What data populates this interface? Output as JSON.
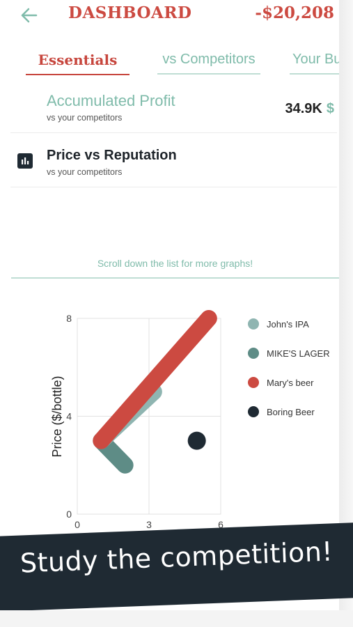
{
  "header": {
    "title": "DASHBOARD",
    "balance": "-$20,208",
    "back_icon": "arrow-left-icon"
  },
  "tabs": [
    {
      "label": "Essentials",
      "active": true
    },
    {
      "label": "vs Competitors",
      "active": false
    },
    {
      "label": "Your Bu",
      "active": false
    }
  ],
  "cards": {
    "profit": {
      "title": "Accumulated Profit",
      "subtitle": "vs your competitors",
      "value": "34.9K",
      "currency": "$"
    },
    "price_rep": {
      "title": "Price vs Reputation",
      "subtitle": "vs your competitors",
      "icon": "bar-chart-icon"
    }
  },
  "scroll_hint": "Scroll down the list for more graphs!",
  "colors": {
    "accent_red": "#cc4a41",
    "accent_teal": "#7fbbaa",
    "dark": "#1f2a33"
  },
  "chart_data": {
    "type": "line",
    "title": "",
    "xlabel": "",
    "ylabel": "Price ($/bottle)",
    "xlim": [
      0,
      6
    ],
    "ylim": [
      0,
      8
    ],
    "xticks": [
      "0",
      "3",
      "6"
    ],
    "yticks": [
      "0",
      "4",
      "8"
    ],
    "grid": true,
    "legend": "right",
    "series": [
      {
        "name": "John's IPA",
        "color": "#8fb5b1",
        "points": [
          [
            1,
            3
          ],
          [
            3.2,
            5
          ]
        ]
      },
      {
        "name": "MIKE'S LAGER",
        "color": "#5e8c86",
        "points": [
          [
            1,
            3
          ],
          [
            2,
            2
          ]
        ]
      },
      {
        "name": "Mary's beer",
        "color": "#cc4a41",
        "points": [
          [
            1,
            3
          ],
          [
            5.5,
            8
          ]
        ]
      },
      {
        "name": "Boring Beer",
        "color": "#1f2a33",
        "points": [
          [
            5,
            3
          ]
        ]
      }
    ]
  },
  "banner": {
    "text": "Study the competition!"
  }
}
